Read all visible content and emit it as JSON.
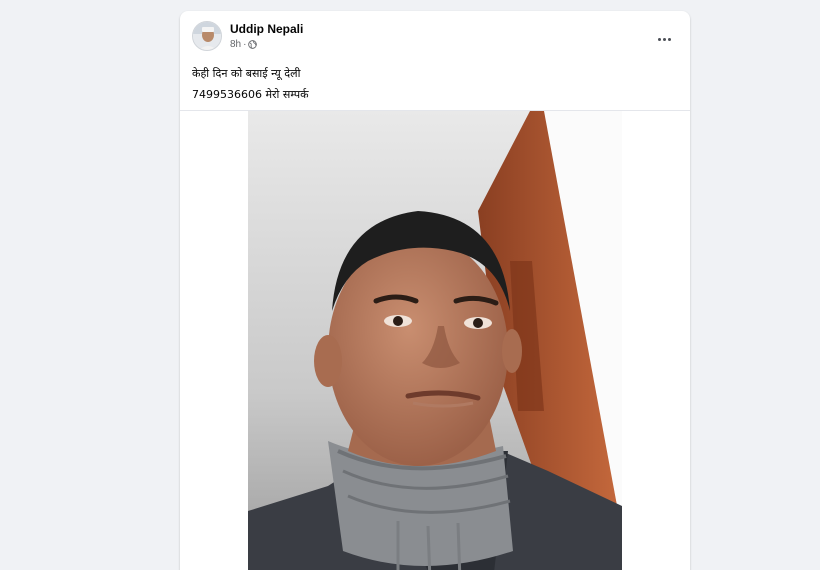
{
  "post": {
    "author": "Uddip Nepali",
    "time": "8h",
    "separator": "·",
    "privacy_icon": "globe-icon",
    "more_icon": "more-horizontal-icon",
    "text_line_1": "केही दिन को बसाई न्यू देली",
    "text_line_2": "7499536606 मेरो सम्पर्क",
    "photo_icon": "selfie-photo"
  },
  "colors": {
    "page_background": "#f0f2f5",
    "card_background": "#ffffff",
    "author_text": "#050505",
    "meta_text": "#65676b"
  }
}
